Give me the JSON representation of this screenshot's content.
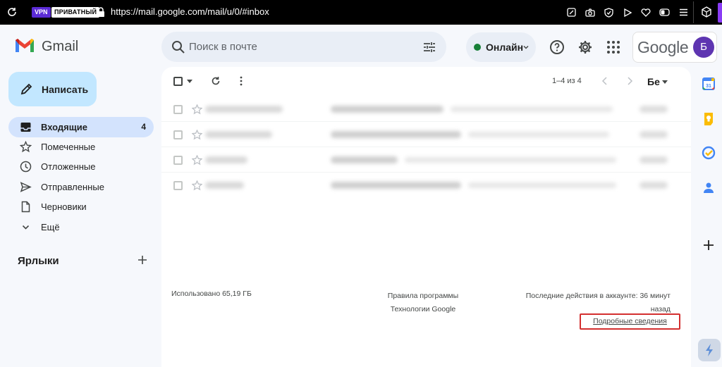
{
  "browser": {
    "vpn_badge": "VPN",
    "private_badge": "ПРИВАТНЫЙ",
    "url": "https://mail.google.com/mail/u/0/#inbox",
    "icons": [
      "edit-page-icon",
      "camera-icon",
      "shield-check-icon",
      "play-icon",
      "heart-icon",
      "toggle-icon",
      "menu-icon"
    ],
    "extension_icon": "cube-icon"
  },
  "header": {
    "app_name": "Gmail",
    "search_placeholder": "Поиск в почте",
    "status_label": "Онлайн",
    "status_color": "#188038",
    "google_word": "Google",
    "avatar_letter": "Б",
    "avatar_color": "#5e35b1"
  },
  "sidebar": {
    "compose_label": "Написать",
    "items": [
      {
        "label": "Входящие",
        "count": "4",
        "icon": "inbox-icon"
      },
      {
        "label": "Помеченные",
        "icon": "star-icon"
      },
      {
        "label": "Отложенные",
        "icon": "clock-icon"
      },
      {
        "label": "Отправленные",
        "icon": "send-icon"
      },
      {
        "label": "Черновики",
        "icon": "draft-icon"
      },
      {
        "label": "Ещё",
        "icon": "chevron-down-icon"
      }
    ],
    "labels_title": "Ярлыки"
  },
  "toolbar": {
    "range": "1–4 из 4",
    "lang": "Бе"
  },
  "footer": {
    "storage": "Использовано 65,19 ГБ",
    "program_rules": "Правила программы",
    "technologies": "Технологии Google",
    "last_activity": "Последние действия в аккаунте: 36 минут назад",
    "details_link": "Подробные сведения"
  },
  "side_panel": {
    "icons": [
      "calendar-icon",
      "keep-icon",
      "tasks-icon",
      "contacts-icon",
      "add-icon"
    ]
  },
  "accent": {
    "compose_bg": "#c2e7ff",
    "active_bg": "#d3e3fd",
    "highlight_border": "#d32f2f"
  }
}
